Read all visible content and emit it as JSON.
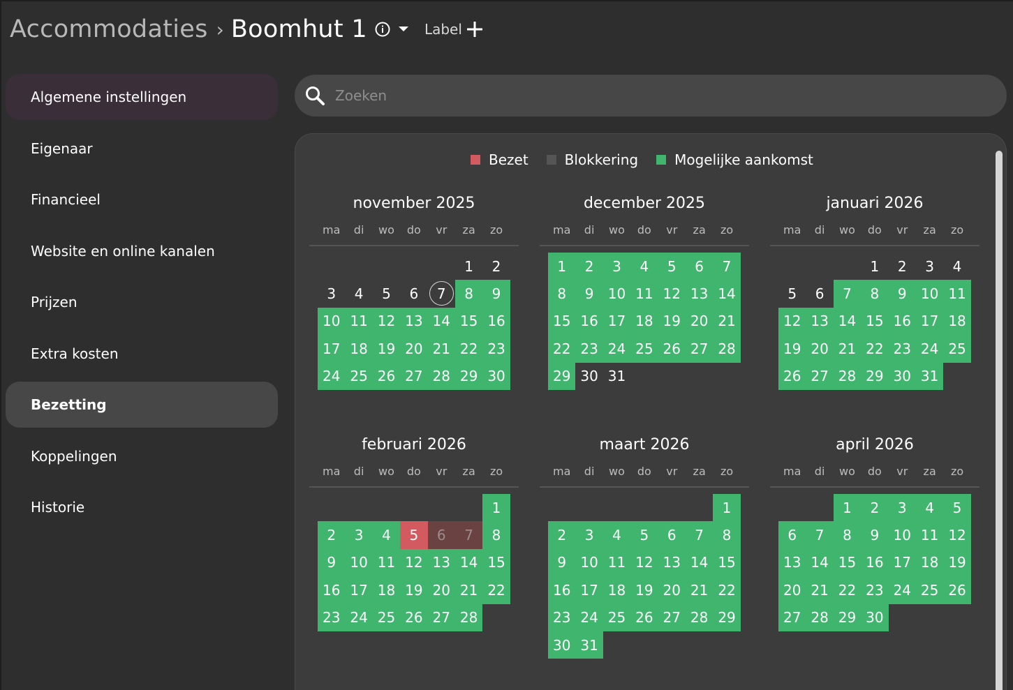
{
  "header": {
    "root": "Accommodaties",
    "separator": "›",
    "current": "Boomhut 1",
    "label_button": "Label"
  },
  "sidebar": {
    "items": [
      {
        "label": "Algemene instellingen"
      },
      {
        "label": "Eigenaar"
      },
      {
        "label": "Financieel"
      },
      {
        "label": "Website en online kanalen"
      },
      {
        "label": "Prijzen"
      },
      {
        "label": "Extra kosten"
      },
      {
        "label": "Bezetting"
      },
      {
        "label": "Koppelingen"
      },
      {
        "label": "Historie"
      }
    ],
    "active": "Bezetting"
  },
  "search": {
    "placeholder": "Zoeken"
  },
  "legend": {
    "items": [
      {
        "label": "Bezet",
        "color": "#d35a5e"
      },
      {
        "label": "Blokkering",
        "color": "#555555"
      },
      {
        "label": "Mogelijke aankomst",
        "color": "#3fb56e"
      }
    ]
  },
  "colors": {
    "available": "#3fb56e",
    "occupied": "#d35a5e",
    "blocked": "#6a4242",
    "background": "#2e2e2e",
    "panel": "#3c3c3c"
  },
  "weekdays": [
    "ma",
    "di",
    "wo",
    "do",
    "vr",
    "za",
    "zo"
  ],
  "months": [
    {
      "title": "november 2025",
      "offset": 5,
      "days": 30,
      "green": [
        8,
        9,
        10,
        11,
        12,
        13,
        14,
        15,
        16,
        17,
        18,
        19,
        20,
        21,
        22,
        23,
        24,
        25,
        26,
        27,
        28,
        29,
        30
      ],
      "red": [],
      "blocked": [],
      "today": 7
    },
    {
      "title": "december 2025",
      "offset": 0,
      "days": 31,
      "green": [
        1,
        2,
        3,
        4,
        5,
        6,
        7,
        8,
        9,
        10,
        11,
        12,
        13,
        14,
        15,
        16,
        17,
        18,
        19,
        20,
        21,
        22,
        23,
        24,
        25,
        26,
        27,
        28,
        29
      ],
      "red": [],
      "blocked": [],
      "today": null
    },
    {
      "title": "januari 2026",
      "offset": 3,
      "days": 31,
      "green": [
        7,
        8,
        9,
        10,
        11,
        12,
        13,
        14,
        15,
        16,
        17,
        18,
        19,
        20,
        21,
        22,
        23,
        24,
        25,
        26,
        27,
        28,
        29,
        30,
        31
      ],
      "red": [],
      "blocked": [],
      "today": null
    },
    {
      "title": "februari 2026",
      "offset": 6,
      "days": 28,
      "green": [
        1,
        2,
        3,
        4,
        8,
        9,
        10,
        11,
        12,
        13,
        14,
        15,
        16,
        17,
        18,
        19,
        20,
        21,
        22,
        23,
        24,
        25,
        26,
        27,
        28
      ],
      "red": [
        5
      ],
      "blocked": [
        6,
        7
      ],
      "today": null
    },
    {
      "title": "maart 2026",
      "offset": 6,
      "days": 31,
      "green": [
        1,
        2,
        3,
        4,
        5,
        6,
        7,
        8,
        9,
        10,
        11,
        12,
        13,
        14,
        15,
        16,
        17,
        18,
        19,
        20,
        21,
        22,
        23,
        24,
        25,
        26,
        27,
        28,
        29,
        30,
        31
      ],
      "red": [],
      "blocked": [],
      "today": null
    },
    {
      "title": "april 2026",
      "offset": 2,
      "days": 30,
      "green": [
        1,
        2,
        3,
        4,
        5,
        6,
        7,
        8,
        9,
        10,
        11,
        12,
        13,
        14,
        15,
        16,
        17,
        18,
        19,
        20,
        21,
        22,
        23,
        24,
        25,
        26,
        27,
        28,
        29,
        30
      ],
      "red": [],
      "blocked": [],
      "today": null
    }
  ]
}
